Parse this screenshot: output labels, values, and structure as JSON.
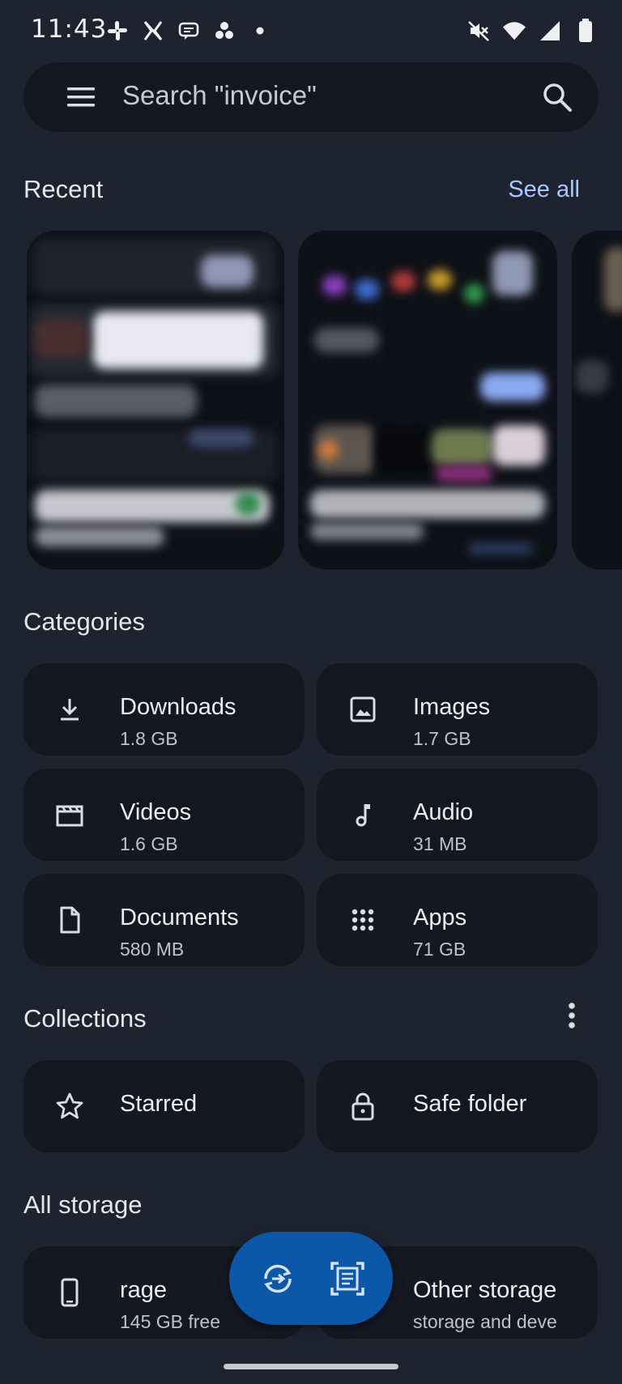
{
  "status_bar": {
    "time": "11:43",
    "left_icons": [
      "slack-icon",
      "x-icon",
      "chat-icon",
      "cluster-icon",
      "dot-icon"
    ],
    "right_icons": [
      "mute-icon",
      "wifi-icon",
      "signal-icon",
      "battery-icon"
    ]
  },
  "search": {
    "placeholder": "Search \"invoice\""
  },
  "recent": {
    "title": "Recent",
    "see_all": "See all"
  },
  "categories": {
    "title": "Categories",
    "items": [
      {
        "label": "Downloads",
        "size": "1.8 GB",
        "icon": "download-icon"
      },
      {
        "label": "Images",
        "size": "1.7 GB",
        "icon": "image-icon"
      },
      {
        "label": "Videos",
        "size": "1.6 GB",
        "icon": "video-icon"
      },
      {
        "label": "Audio",
        "size": "31 MB",
        "icon": "music-note-icon"
      },
      {
        "label": "Documents",
        "size": "580 MB",
        "icon": "document-icon"
      },
      {
        "label": "Apps",
        "size": "71 GB",
        "icon": "apps-grid-icon"
      }
    ]
  },
  "collections": {
    "title": "Collections",
    "items": [
      {
        "label": "Starred",
        "icon": "star-icon"
      },
      {
        "label": "Safe folder",
        "icon": "lock-icon"
      }
    ]
  },
  "all_storage": {
    "title": "All storage",
    "items": [
      {
        "label": "rage",
        "sub": "145 GB free",
        "icon": "phone-icon"
      },
      {
        "label": "Other storage",
        "sub": "storage and deve"
      }
    ]
  },
  "colors": {
    "background": "#1f2330",
    "card": "#151821",
    "accent": "#a9c7ff",
    "fab": "#0b57a8"
  }
}
